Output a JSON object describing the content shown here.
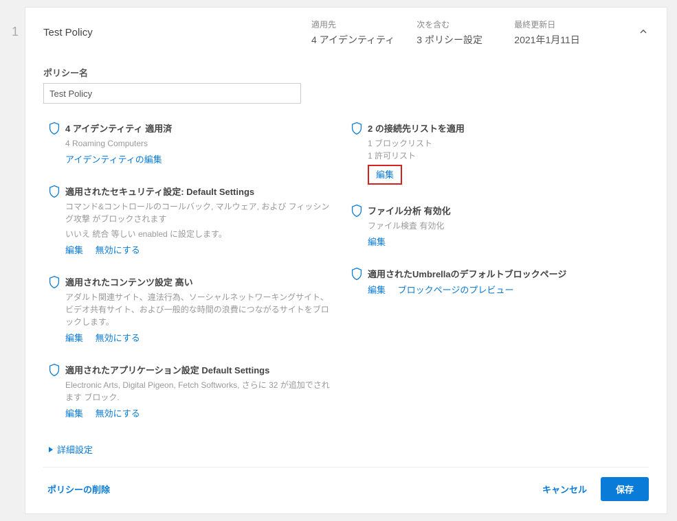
{
  "row_number": "1",
  "header": {
    "title": "Test Policy",
    "applied_label": "適用先",
    "applied_value": "4 アイデンティティ",
    "contains_label": "次を含む",
    "contains_value": "3 ポリシー設定",
    "updated_label": "最終更新日",
    "updated_value": "2021年1月11日"
  },
  "policy_name": {
    "label": "ポリシー名",
    "value": "Test Policy"
  },
  "left": {
    "identities": {
      "title": "4 アイデンティティ 適用済",
      "desc": "4 Roaming Computers",
      "edit": "アイデンティティの編集"
    },
    "security": {
      "title": "適用されたセキュリティ設定: Default Settings",
      "desc1": "コマンド&コントロールのコールバック, マルウェア, および フィッシング攻撃 がブロックされます",
      "desc2": "いいえ 統合 等しい enabled に設定します。",
      "edit": "編集",
      "disable": "無効にする"
    },
    "content": {
      "title": "適用されたコンテンツ設定 高い",
      "desc": "アダルト関連サイト、違法行為、ソーシャルネットワーキングサイト、ビデオ共有サイト、および一般的な時間の浪費につながるサイトをブロックします。",
      "edit": "編集",
      "disable": "無効にする"
    },
    "app": {
      "title": "適用されたアプリケーション設定 Default Settings",
      "desc": "Electronic Arts, Digital Pigeon, Fetch Softworks, さらに 32 が追加でされます ブロック.",
      "edit": "編集",
      "disable": "無効にする"
    }
  },
  "right": {
    "destlists": {
      "title": "2 の接続先リストを適用",
      "desc1": "1 ブロックリスト",
      "desc2": "1 許可リスト",
      "edit": "編集"
    },
    "fileanalysis": {
      "title": "ファイル分析 有効化",
      "desc": "ファイル検査 有効化",
      "edit": "編集"
    },
    "blockpage": {
      "title": "適用されたUmbrellaのデフォルトブロックページ",
      "edit": "編集",
      "preview": "ブロックページのプレビュー"
    }
  },
  "advanced": "詳細設定",
  "footer": {
    "delete": "ポリシーの削除",
    "cancel": "キャンセル",
    "save": "保存"
  }
}
